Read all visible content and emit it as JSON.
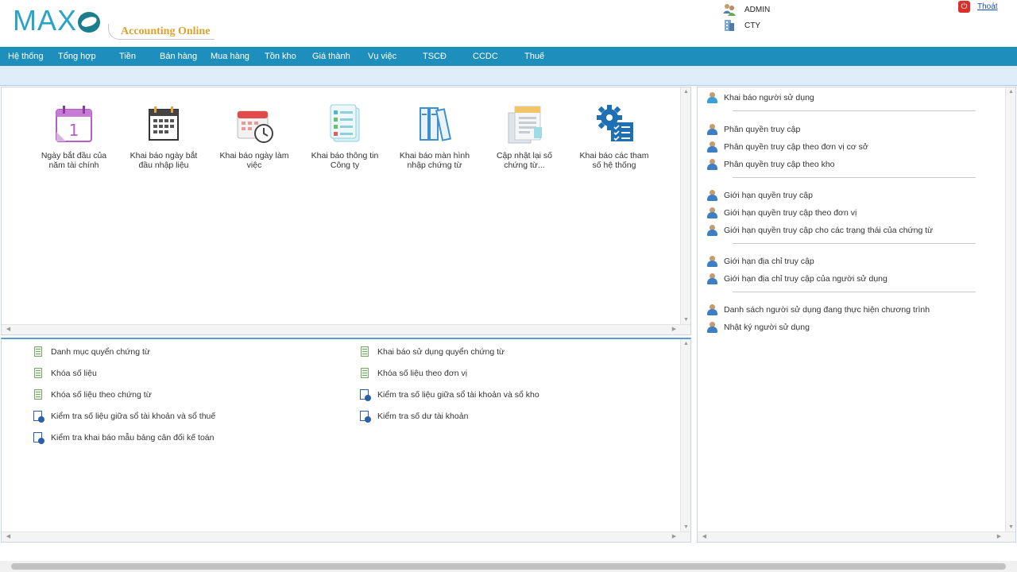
{
  "app": {
    "logo_text": "MAXO",
    "logo_tagline": "Accounting Online"
  },
  "user": {
    "name": "ADMIN",
    "company": "CTY",
    "logout_label": "Thoát"
  },
  "menu": [
    {
      "label": "Hệ thống"
    },
    {
      "label": "Tổng hợp"
    },
    {
      "label": "Tiền"
    },
    {
      "label": "Bán hàng"
    },
    {
      "label": "Mua hàng"
    },
    {
      "label": "Tồn kho"
    },
    {
      "label": "Giá thành"
    },
    {
      "label": "Vụ việc"
    },
    {
      "label": "TSCĐ"
    },
    {
      "label": "CCDC"
    },
    {
      "label": "Thuế"
    }
  ],
  "tiles": [
    {
      "label": "Ngày bắt đầu của năm tài chính",
      "icon": "calendar-icon"
    },
    {
      "label": "Khai báo ngày bắt đầu nhập liệu",
      "icon": "calendar-grid-icon"
    },
    {
      "label": "Khai báo ngày làm việc",
      "icon": "calendar-clock-icon"
    },
    {
      "label": "Khai báo thông tin Công ty",
      "icon": "checklist-icon"
    },
    {
      "label": "Khai báo màn hình nhập chứng từ",
      "icon": "binders-icon"
    },
    {
      "label": "Cập nhật lại số chứng từ...",
      "icon": "documents-icon"
    },
    {
      "label": "Khai báo các tham số hệ thống",
      "icon": "gear-settings-icon"
    }
  ],
  "bottom_left": [
    {
      "label": "Danh mục quyển chứng từ",
      "icon": "document-list-icon"
    },
    {
      "label": "Khóa số liệu",
      "icon": "document-lock-icon"
    },
    {
      "label": "Khóa số liệu theo chứng từ",
      "icon": "document-lock-icon"
    },
    {
      "label": "Kiểm tra số liệu giữa sổ tài khoản và sổ thuế",
      "icon": "document-check-icon"
    },
    {
      "label": "Kiểm tra khai báo mẫu bảng cân đối kế toán",
      "icon": "document-check-icon"
    }
  ],
  "bottom_right": [
    {
      "label": "Khai báo sử dụng quyển chứng từ",
      "icon": "document-list-icon"
    },
    {
      "label": "Khóa số liệu theo đơn vị",
      "icon": "document-lock-icon"
    },
    {
      "label": "Kiểm tra số liệu giữa sổ tài khoản và sổ kho",
      "icon": "document-check-icon"
    },
    {
      "label": "Kiểm tra số dư tài khoản",
      "icon": "document-check-icon"
    }
  ],
  "right_list": [
    {
      "label": "Khai báo người sử dụng"
    },
    {
      "label": "Phân quyền truy cập"
    },
    {
      "label": "Phân quyền truy cập theo đơn vị cơ sở"
    },
    {
      "label": "Phân quyền truy cập theo kho"
    },
    {
      "label": "Giới hạn quyền truy cập"
    },
    {
      "label": "Giới hạn quyền truy cập theo đơn vị"
    },
    {
      "label": "Giới hạn quyền truy cập cho các trạng thái của chứng từ"
    },
    {
      "label": "Giới hạn địa chỉ truy cập"
    },
    {
      "label": "Giới hạn địa chỉ truy cập của người sử dụng"
    },
    {
      "label": "Danh sách người sử dụng đang thực hiện chương trình"
    },
    {
      "label": "Nhật ký người sử dụng"
    }
  ],
  "colors": {
    "menu_bg": "#1e8fbd",
    "subbar_bg": "#deedf9",
    "logo_blue": "#2aa3c9",
    "tagline_gold": "#d9a22a"
  }
}
